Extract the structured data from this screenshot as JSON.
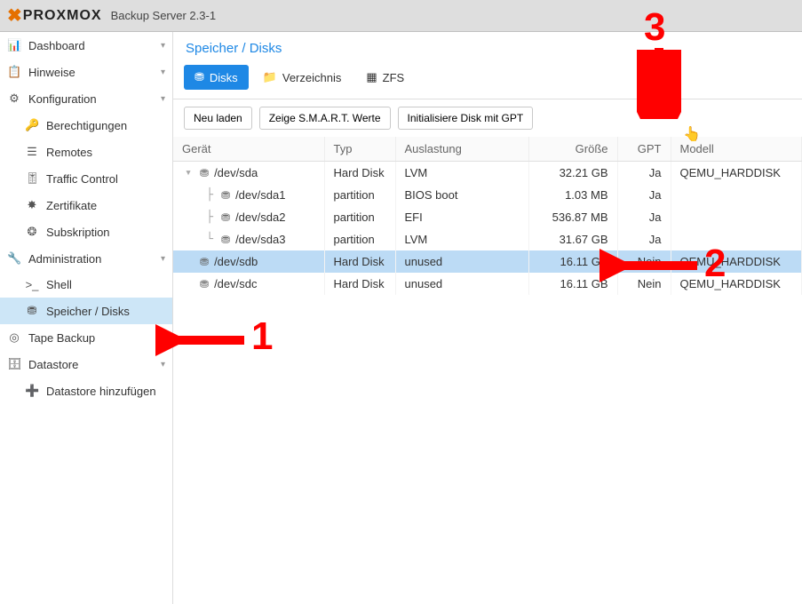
{
  "header": {
    "product": "PROXMOX",
    "title": "Backup Server 2.3-1"
  },
  "sidebar": {
    "items": [
      {
        "label": "Dashboard",
        "icon": "tachometer",
        "expand": false
      },
      {
        "label": "Hinweise",
        "icon": "clipboard",
        "expand": false
      },
      {
        "label": "Konfiguration",
        "icon": "cogs",
        "expand": true,
        "children": [
          {
            "label": "Berechtigungen",
            "icon": "key"
          },
          {
            "label": "Remotes",
            "icon": "server"
          },
          {
            "label": "Traffic Control",
            "icon": "sliders"
          },
          {
            "label": "Zertifikate",
            "icon": "certificate"
          },
          {
            "label": "Subskription",
            "icon": "support"
          }
        ]
      },
      {
        "label": "Administration",
        "icon": "wrench",
        "expand": true,
        "children": [
          {
            "label": "Shell",
            "icon": "terminal"
          },
          {
            "label": "Speicher / Disks",
            "icon": "hdd",
            "selected": true
          }
        ]
      },
      {
        "label": "Tape Backup",
        "icon": "tape",
        "expand": false
      },
      {
        "label": "Datastore",
        "icon": "database",
        "expand": true,
        "children": [
          {
            "label": "Datastore hinzufügen",
            "icon": "plus"
          }
        ]
      }
    ]
  },
  "panel": {
    "title": "Speicher / Disks",
    "tabs": [
      {
        "label": "Disks",
        "icon": "hdd",
        "active": true
      },
      {
        "label": "Verzeichnis",
        "icon": "folder",
        "active": false
      },
      {
        "label": "ZFS",
        "icon": "th",
        "active": false
      }
    ],
    "toolbar": {
      "reload": "Neu laden",
      "smart": "Zeige S.M.A.R.T. Werte",
      "init": "Initialisiere Disk mit GPT"
    },
    "columns": {
      "device": "Gerät",
      "type": "Typ",
      "usage": "Auslastung",
      "size": "Größe",
      "gpt": "GPT",
      "model": "Modell"
    },
    "rows": [
      {
        "level": 0,
        "expander": "▾",
        "device": "/dev/sda",
        "type": "Hard Disk",
        "usage": "LVM",
        "size": "32.21 GB",
        "gpt": "Ja",
        "model": "QEMU_HARDDISK"
      },
      {
        "level": 1,
        "branch": "├",
        "device": "/dev/sda1",
        "type": "partition",
        "usage": "BIOS boot",
        "size": "1.03 MB",
        "gpt": "Ja",
        "model": ""
      },
      {
        "level": 1,
        "branch": "├",
        "device": "/dev/sda2",
        "type": "partition",
        "usage": "EFI",
        "size": "536.87 MB",
        "gpt": "Ja",
        "model": ""
      },
      {
        "level": 1,
        "branch": "└",
        "device": "/dev/sda3",
        "type": "partition",
        "usage": "LVM",
        "size": "31.67 GB",
        "gpt": "Ja",
        "model": ""
      },
      {
        "level": 0,
        "device": "/dev/sdb",
        "type": "Hard Disk",
        "usage": "unused",
        "size": "16.11 GB",
        "gpt": "Nein",
        "model": "QEMU_HARDDISK",
        "selected": true
      },
      {
        "level": 0,
        "device": "/dev/sdc",
        "type": "Hard Disk",
        "usage": "unused",
        "size": "16.11 GB",
        "gpt": "Nein",
        "model": "QEMU_HARDDISK"
      }
    ]
  },
  "annotations": {
    "n1": "1",
    "n2": "2",
    "n3": "3"
  }
}
